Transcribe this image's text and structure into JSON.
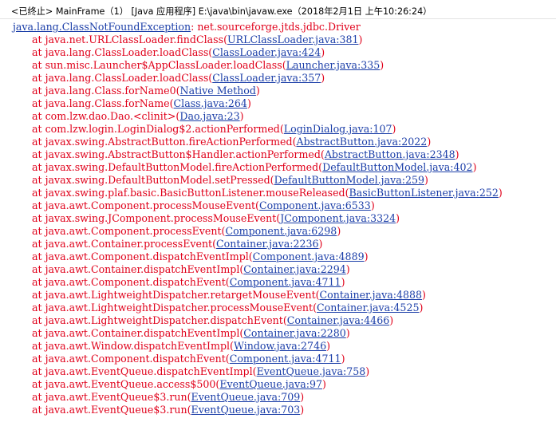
{
  "header": {
    "title": "<已终止> MainFrame（1） [Java 应用程序] E:\\java\\bin\\javaw.exe（2018年2月1日 上午10:26:24）"
  },
  "console": {
    "exception": {
      "type": "java.lang.ClassNotFoundException",
      "message": ": net.sourceforge.jtds.jdbc.Driver"
    },
    "frames": [
      {
        "method": "at java.net.URLClassLoader.findClass(",
        "location": "URLClassLoader.java:381"
      },
      {
        "method": "at java.lang.ClassLoader.loadClass(",
        "location": "ClassLoader.java:424"
      },
      {
        "method": "at sun.misc.Launcher$AppClassLoader.loadClass(",
        "location": "Launcher.java:335"
      },
      {
        "method": "at java.lang.ClassLoader.loadClass(",
        "location": "ClassLoader.java:357"
      },
      {
        "method": "at java.lang.Class.forName0(",
        "location": "Native Method"
      },
      {
        "method": "at java.lang.Class.forName(",
        "location": "Class.java:264"
      },
      {
        "method": "at com.lzw.dao.Dao.<clinit>(",
        "location": "Dao.java:23"
      },
      {
        "method": "at com.lzw.login.LoginDialog$2.actionPerformed(",
        "location": "LoginDialog.java:107"
      },
      {
        "method": "at javax.swing.AbstractButton.fireActionPerformed(",
        "location": "AbstractButton.java:2022"
      },
      {
        "method": "at javax.swing.AbstractButton$Handler.actionPerformed(",
        "location": "AbstractButton.java:2348"
      },
      {
        "method": "at javax.swing.DefaultButtonModel.fireActionPerformed(",
        "location": "DefaultButtonModel.java:402"
      },
      {
        "method": "at javax.swing.DefaultButtonModel.setPressed(",
        "location": "DefaultButtonModel.java:259"
      },
      {
        "method": "at javax.swing.plaf.basic.BasicButtonListener.mouseReleased(",
        "location": "BasicButtonListener.java:252"
      },
      {
        "method": "at java.awt.Component.processMouseEvent(",
        "location": "Component.java:6533"
      },
      {
        "method": "at javax.swing.JComponent.processMouseEvent(",
        "location": "JComponent.java:3324"
      },
      {
        "method": "at java.awt.Component.processEvent(",
        "location": "Component.java:6298"
      },
      {
        "method": "at java.awt.Container.processEvent(",
        "location": "Container.java:2236"
      },
      {
        "method": "at java.awt.Component.dispatchEventImpl(",
        "location": "Component.java:4889"
      },
      {
        "method": "at java.awt.Container.dispatchEventImpl(",
        "location": "Container.java:2294"
      },
      {
        "method": "at java.awt.Component.dispatchEvent(",
        "location": "Component.java:4711"
      },
      {
        "method": "at java.awt.LightweightDispatcher.retargetMouseEvent(",
        "location": "Container.java:4888"
      },
      {
        "method": "at java.awt.LightweightDispatcher.processMouseEvent(",
        "location": "Container.java:4525"
      },
      {
        "method": "at java.awt.LightweightDispatcher.dispatchEvent(",
        "location": "Container.java:4466"
      },
      {
        "method": "at java.awt.Container.dispatchEventImpl(",
        "location": "Container.java:2280"
      },
      {
        "method": "at java.awt.Window.dispatchEventImpl(",
        "location": "Window.java:2746"
      },
      {
        "method": "at java.awt.Component.dispatchEvent(",
        "location": "Component.java:4711"
      },
      {
        "method": "at java.awt.EventQueue.dispatchEventImpl(",
        "location": "EventQueue.java:758"
      },
      {
        "method": "at java.awt.EventQueue.access$500(",
        "location": "EventQueue.java:97"
      },
      {
        "method": "at java.awt.EventQueue$3.run(",
        "location": "EventQueue.java:709"
      },
      {
        "method": "at java.awt.EventQueue$3.run(",
        "location": "EventQueue.java:703"
      }
    ],
    "close_paren": ")"
  },
  "colors": {
    "error_text": "#e0001a",
    "link_text": "#1b3ea8",
    "background": "#ffffff"
  }
}
